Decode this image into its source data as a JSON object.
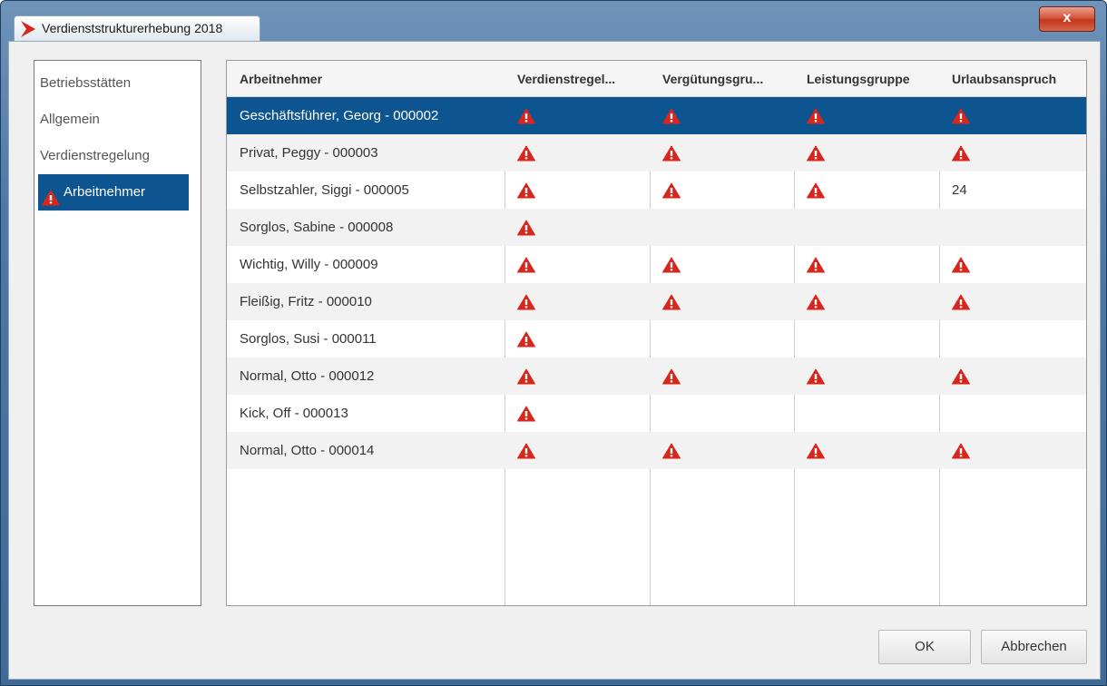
{
  "window": {
    "title": "Verdienststrukturerhebung 2018",
    "close_label": "x",
    "accent_color": "#0d5590",
    "warning_color": "#d9261c"
  },
  "nav": {
    "items": [
      {
        "label": "Betriebsstätten",
        "active": false,
        "warning": false
      },
      {
        "label": "Allgemein",
        "active": false,
        "warning": false
      },
      {
        "label": "Verdienstregelung",
        "active": false,
        "warning": false
      },
      {
        "label": "Arbeitnehmer",
        "active": true,
        "warning": true,
        "icon": "warning-icon"
      }
    ]
  },
  "table": {
    "columns": [
      "Arbeitnehmer",
      "Verdienstregel...",
      "Vergütungsgru...",
      "Leistungsgruppe",
      "Urlaubsanspruch"
    ],
    "rows": [
      {
        "name": "Geschäftsführer, Georg - 000002",
        "cells": [
          "warn",
          "warn",
          "warn",
          "warn"
        ],
        "selected": true
      },
      {
        "name": "Privat, Peggy - 000003",
        "cells": [
          "warn",
          "warn",
          "warn",
          "warn"
        ]
      },
      {
        "name": "Selbstzahler, Siggi - 000005",
        "cells": [
          "warn",
          "warn",
          "warn",
          "24"
        ]
      },
      {
        "name": "Sorglos, Sabine - 000008",
        "cells": [
          "warn",
          "",
          "",
          ""
        ]
      },
      {
        "name": "Wichtig, Willy - 000009",
        "cells": [
          "warn",
          "warn",
          "warn",
          "warn"
        ]
      },
      {
        "name": "Fleißig, Fritz - 000010",
        "cells": [
          "warn",
          "warn",
          "warn",
          "warn"
        ]
      },
      {
        "name": "Sorglos, Susi - 000011",
        "cells": [
          "warn",
          "",
          "",
          ""
        ]
      },
      {
        "name": "Normal, Otto - 000012",
        "cells": [
          "warn",
          "warn",
          "warn",
          "warn"
        ]
      },
      {
        "name": "Kick, Off - 000013",
        "cells": [
          "warn",
          "",
          "",
          ""
        ]
      },
      {
        "name": "Normal, Otto - 000014",
        "cells": [
          "warn",
          "warn",
          "warn",
          "warn"
        ]
      }
    ]
  },
  "buttons": {
    "ok_label": "OK",
    "cancel_label": "Abbrechen"
  }
}
